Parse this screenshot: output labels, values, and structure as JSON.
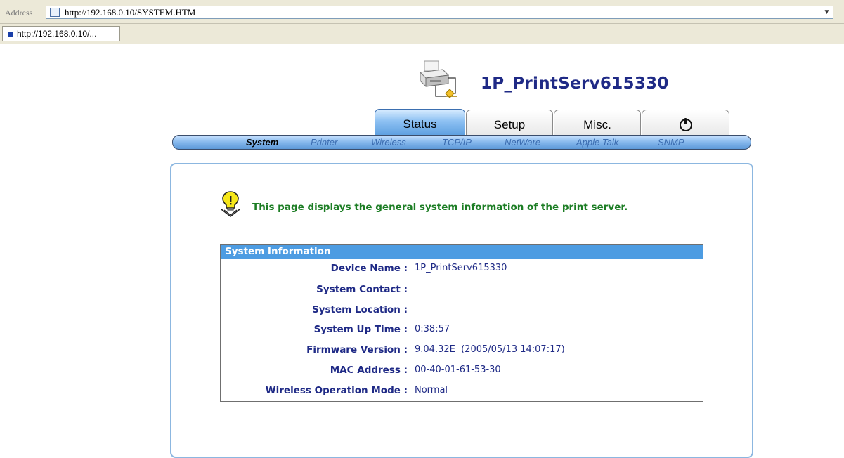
{
  "browser": {
    "address_label": "Address",
    "url": "http://192.168.0.10/SYSTEM.HTM",
    "tab_title": "http://192.168.0.10/..."
  },
  "header": {
    "device_title": "1P_PrintServ615330"
  },
  "main_tabs": [
    {
      "label": "Status",
      "active": true
    },
    {
      "label": "Setup",
      "active": false
    },
    {
      "label": "Misc.",
      "active": false
    },
    {
      "label": "",
      "icon": "power-icon",
      "active": false
    }
  ],
  "sub_nav": [
    {
      "label": "System",
      "active": true
    },
    {
      "label": "Printer",
      "active": false
    },
    {
      "label": "Wireless",
      "active": false
    },
    {
      "label": "TCP/IP",
      "active": false
    },
    {
      "label": "NetWare",
      "active": false
    },
    {
      "label": "Apple Talk",
      "active": false
    },
    {
      "label": "SNMP",
      "active": false
    }
  ],
  "hint": {
    "icon": "lightbulb-icon",
    "text": "This page displays the general system information of the print server."
  },
  "system_info": {
    "heading": "System Information",
    "rows": [
      {
        "label": "Device Name :",
        "value": "1P_PrintServ615330"
      },
      {
        "label": "System Contact :",
        "value": ""
      },
      {
        "label": "System Location :",
        "value": ""
      },
      {
        "label": "System Up Time :",
        "value": "0:38:57"
      },
      {
        "label": "Firmware Version :",
        "value": "9.04.32E  (2005/05/13 14:07:17)"
      },
      {
        "label": "MAC Address :",
        "value": "00-40-01-61-53-30"
      },
      {
        "label": "Wireless Operation Mode :",
        "value": "Normal"
      }
    ]
  },
  "colors": {
    "title_navy": "#1f2a86",
    "hint_green": "#1c7d24",
    "table_header_blue": "#4d9ce2",
    "nav_blue": "#5d9fe0"
  }
}
